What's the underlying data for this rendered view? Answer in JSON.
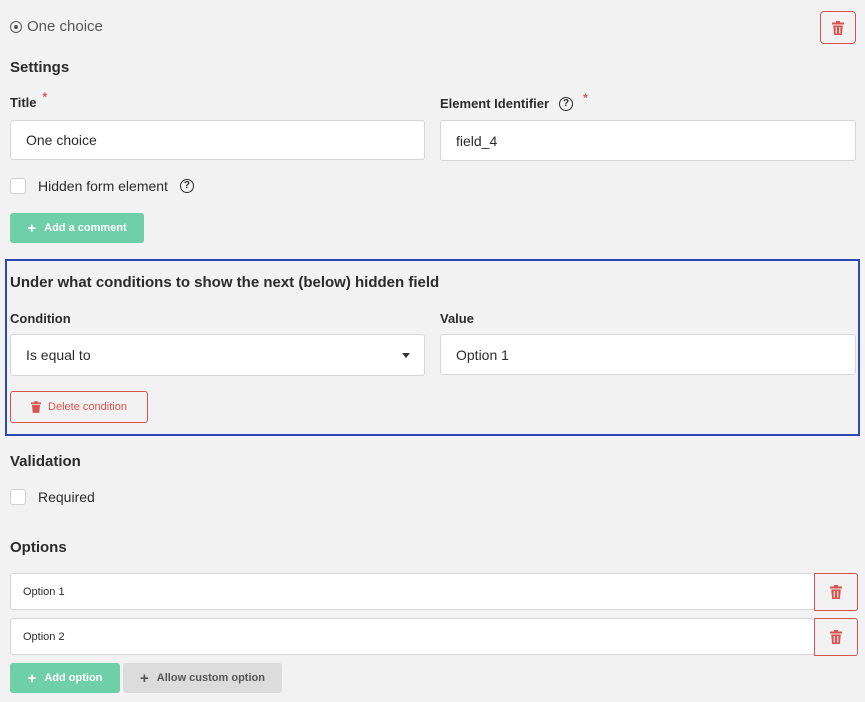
{
  "header": {
    "title": "One choice"
  },
  "settings": {
    "heading": "Settings",
    "title_label": "Title",
    "title_value": "One choice",
    "identifier_label": "Element Identifier",
    "identifier_value": "field_4",
    "required_mark": "*",
    "help_glyph": "?",
    "hidden_label": "Hidden form element",
    "add_comment_label": "Add a comment"
  },
  "condition": {
    "heading": "Under what conditions to show the next (below) hidden field",
    "condition_label": "Condition",
    "condition_value": "Is equal to",
    "value_label": "Value",
    "value_value": "Option 1",
    "delete_label": "Delete condition"
  },
  "validation": {
    "heading": "Validation",
    "required_label": "Required"
  },
  "options": {
    "heading": "Options",
    "items": [
      {
        "label": "Option 1"
      },
      {
        "label": "Option 2"
      }
    ],
    "add_label": "Add option",
    "custom_label": "Allow custom option"
  },
  "colors": {
    "accent": "#6fcfa9",
    "danger": "#d9534f",
    "highlight": "#2f46b5"
  },
  "icons": {
    "type": "radio-icon",
    "delete": "trash-icon",
    "help": "help-icon",
    "add": "plus-icon"
  }
}
